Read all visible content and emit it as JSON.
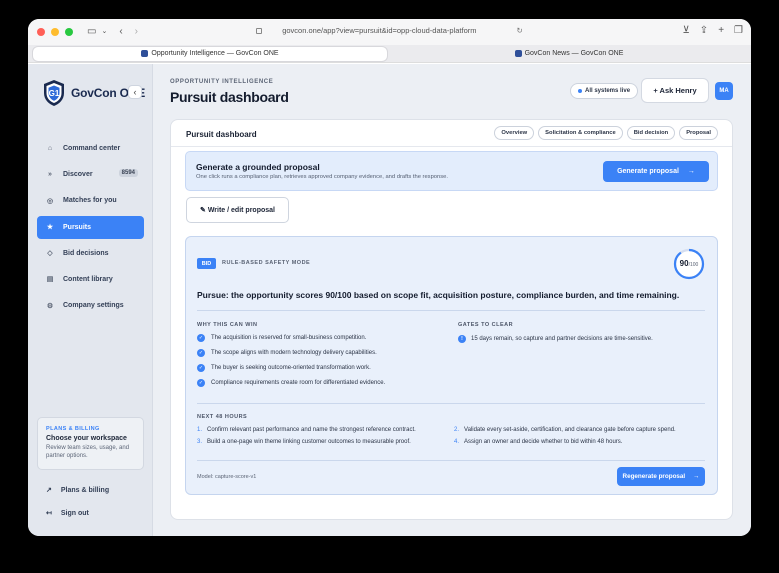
{
  "browser": {
    "url": "govcon.one/app?view=pursuit&id=opp-cloud-data-platform",
    "tabs": [
      {
        "label": "Opportunity Intelligence — GovCon ONE"
      },
      {
        "label": "GovCon News — GovCon ONE"
      }
    ]
  },
  "brand": {
    "name": "GovCon ONE",
    "collapse_icon": "‹"
  },
  "sidebar": {
    "items": [
      {
        "label": "Command center",
        "icon": "⌂"
      },
      {
        "label": "Discover",
        "icon": "»",
        "badge": "8594"
      },
      {
        "label": "Matches for you",
        "icon": "◎"
      },
      {
        "label": "Pursuits",
        "icon": "★"
      },
      {
        "label": "Bid decisions",
        "icon": "◇"
      },
      {
        "label": "Content library",
        "icon": "▤"
      },
      {
        "label": "Company settings",
        "icon": "⚙"
      }
    ],
    "plans_card": {
      "kicker": "PLANS & BILLING",
      "title": "Choose your workspace",
      "desc": "Review team sizes, usage, and partner options."
    },
    "footer": [
      {
        "label": "Plans & billing",
        "icon": "↗"
      },
      {
        "label": "Sign out",
        "icon": "↤"
      }
    ]
  },
  "header": {
    "kicker": "OPPORTUNITY INTELLIGENCE",
    "title": "Pursuit dashboard",
    "status": "All systems live",
    "ask": "+ Ask Henry",
    "avatar": "MA"
  },
  "panel": {
    "title": "Pursuit dashboard",
    "tabs": [
      "Overview",
      "Solicitation & compliance",
      "Bid decision",
      "Proposal"
    ],
    "generate": {
      "title": "Generate a grounded proposal",
      "subtitle": "One click runs a compliance plan, retrieves approved company evidence, and drafts the response.",
      "button": "Generate proposal",
      "arrow": "→"
    },
    "write_button": "✎ Write / edit proposal",
    "analysis": {
      "tag": "BID",
      "mode": "RULE-BASED SAFETY MODE",
      "score": "90",
      "score_total": "/100",
      "score_fraction": 0.9,
      "verdict": "Pursue: the opportunity scores 90/100 based on scope fit, acquisition posture, compliance burden, and time remaining.",
      "why_heading": "WHY THIS CAN WIN",
      "why": [
        "The acquisition is reserved for small-business competition.",
        "The scope aligns with modern technology delivery capabilities.",
        "The buyer is seeking outcome-oriented transformation work.",
        "Compliance requirements create room for differentiated evidence."
      ],
      "gates_heading": "GATES TO CLEAR",
      "gates": [
        "15 days remain, so capture and partner decisions are time-sensitive."
      ],
      "next_heading": "NEXT 48 HOURS",
      "next": [
        {
          "n": "1.",
          "text": "Confirm relevant past performance and name the strongest reference contract."
        },
        {
          "n": "2.",
          "text": "Validate every set-aside, certification, and clearance gate before capture spend."
        },
        {
          "n": "3.",
          "text": "Build a one-page win theme linking customer outcomes to measurable proof."
        },
        {
          "n": "4.",
          "text": "Assign an owner and decide whether to bid within 48 hours."
        }
      ],
      "model": "Model: capture-score-v1",
      "regen": "Regenerate proposal",
      "regen_arrow": "→"
    }
  },
  "colors": {
    "accent": "#3b82f6",
    "sidebar_bg": "#e3e7ee",
    "navy": "#1a2a4f"
  }
}
